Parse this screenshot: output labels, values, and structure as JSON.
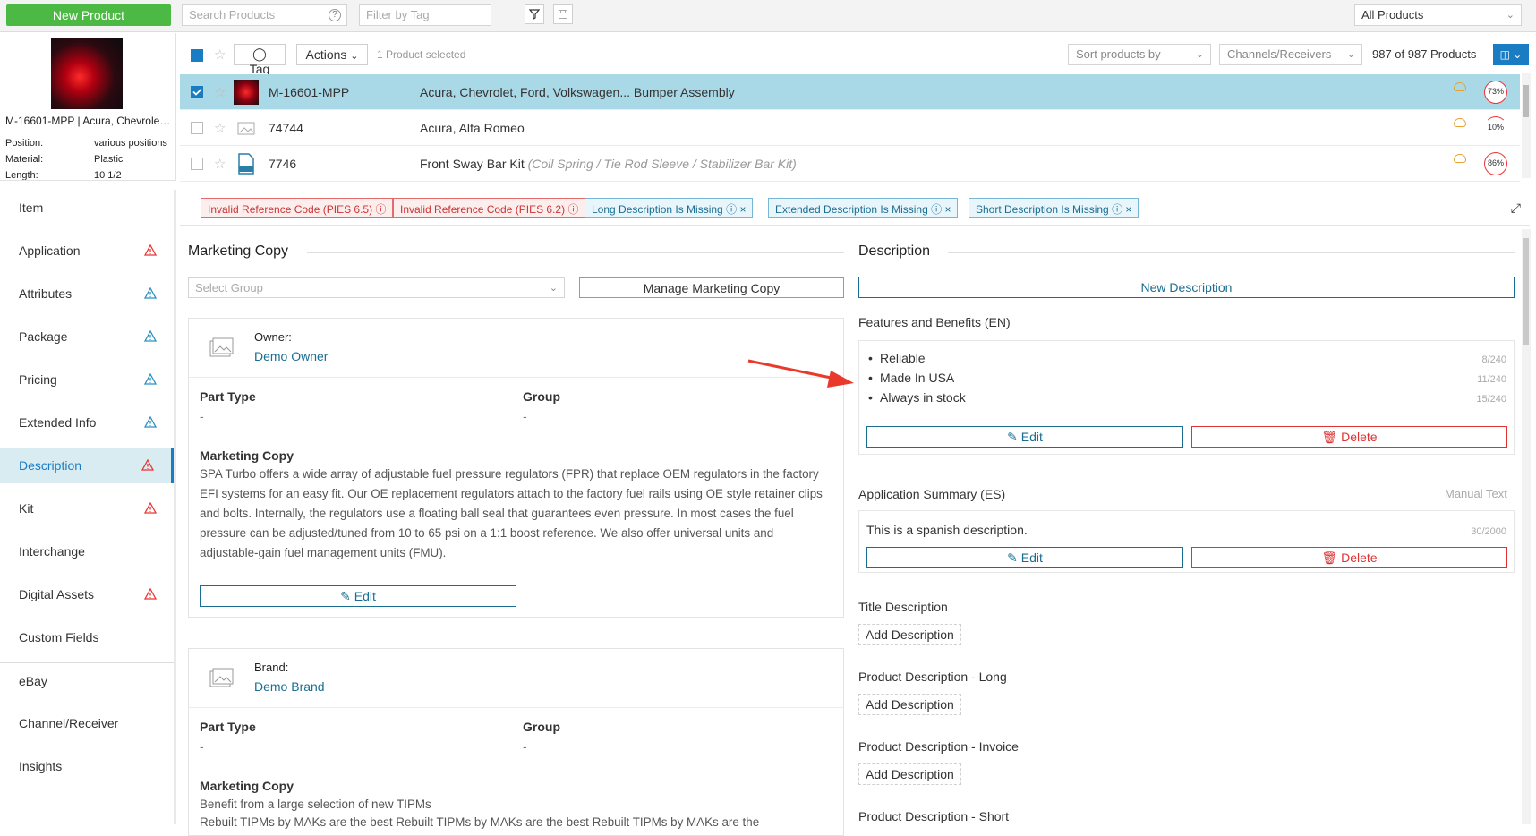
{
  "toolbar": {
    "new_product_label": "New Product",
    "search_placeholder": "Search Products",
    "tag_filter_placeholder": "Filter by Tag",
    "all_products": "All Products"
  },
  "preview": {
    "title": "M-16601-MPP | Acura, Chevrolet, Ford, Volkswagen...",
    "attributes": [
      {
        "label": "Position:",
        "value": "various positions"
      },
      {
        "label": "Material:",
        "value": "Plastic"
      },
      {
        "label": "Length:",
        "value": "10 1/2"
      }
    ]
  },
  "list": {
    "tag_label": "Tag",
    "actions_label": "Actions",
    "selected_text": "1 Product selected",
    "sort_placeholder": "Sort products by",
    "channels_placeholder": "Channels/Receivers",
    "count_text": "987 of 987 Products",
    "rows": [
      {
        "part": "M-16601-MPP",
        "desc": "Acura, Chevrolet, Ford, Volkswagen... Bumper Assembly",
        "extra": "",
        "pct": "73%",
        "selected": true
      },
      {
        "part": "74744",
        "desc": "Acura, Alfa Romeo",
        "extra": "",
        "pct": "10%",
        "selected": false
      },
      {
        "part": "7746",
        "desc": "Front Sway Bar Kit",
        "extra": "(Coil Spring / Tie Rod Sleeve / Stabilizer Bar Kit)",
        "pct": "86%",
        "selected": false
      }
    ]
  },
  "nav": [
    {
      "label": "Item",
      "warn": "none"
    },
    {
      "label": "Application",
      "warn": "red"
    },
    {
      "label": "Attributes",
      "warn": "blue"
    },
    {
      "label": "Package",
      "warn": "blue"
    },
    {
      "label": "Pricing",
      "warn": "blue"
    },
    {
      "label": "Extended Info",
      "warn": "blue"
    },
    {
      "label": "Description",
      "warn": "red",
      "active": true
    },
    {
      "label": "Kit",
      "warn": "red"
    },
    {
      "label": "Interchange",
      "warn": "none"
    },
    {
      "label": "Digital Assets",
      "warn": "red"
    },
    {
      "label": "Custom Fields",
      "warn": "none"
    },
    {
      "label": "eBay",
      "warn": "none"
    },
    {
      "label": "Channel/Receiver",
      "warn": "none"
    },
    {
      "label": "Insights",
      "warn": "none"
    }
  ],
  "issues": [
    {
      "label": "Invalid Reference Code (PIES 6.5)",
      "type": "error"
    },
    {
      "label": "Invalid Reference Code (PIES 6.2)",
      "type": "error"
    },
    {
      "label": "Long Description Is Missing",
      "type": "info"
    },
    {
      "label": "Extended Description Is Missing",
      "type": "info"
    },
    {
      "label": "Short Description Is Missing",
      "type": "info"
    }
  ],
  "marketing": {
    "title": "Marketing Copy",
    "select_group_placeholder": "Select Group",
    "manage_label": "Manage Marketing Copy",
    "cards": [
      {
        "owner_label": "Owner:",
        "owner_value": "Demo Owner",
        "part_type_label": "Part Type",
        "part_type_value": "-",
        "group_label": "Group",
        "group_value": "-",
        "copy_label": "Marketing Copy",
        "copy_text": "SPA Turbo offers a wide array of adjustable fuel pressure regulators (FPR) that replace OEM regulators in the factory EFI systems for an easy fit. Our OE replacement regulators attach to the factory fuel rails using OE style retainer clips and bolts. Internally, the regulators use a floating ball seal that guarantees even pressure. In most cases the fuel pressure can be adjusted/tuned from 10 to 65 psi on a 1:1 boost reference. We also offer universal units and adjustable-gain fuel management units (FMU).",
        "edit_label": "Edit"
      },
      {
        "owner_label": "Brand:",
        "owner_value": "Demo Brand",
        "part_type_label": "Part Type",
        "part_type_value": "-",
        "group_label": "Group",
        "group_value": "-",
        "copy_label": "Marketing Copy",
        "copy_text": "Benefit from a large selection of new TIPMs",
        "copy_text_2": "Rebuilt TIPMs by MAKs are the best Rebuilt TIPMs by MAKs are the best Rebuilt TIPMs by MAKs are the"
      }
    ]
  },
  "description": {
    "title": "Description",
    "new_label": "New Description",
    "features_title": "Features and Benefits (EN)",
    "features": [
      {
        "text": "Reliable",
        "count": "8/240"
      },
      {
        "text": "Made In USA",
        "count": "11/240"
      },
      {
        "text": "Always in stock",
        "count": "15/240"
      }
    ],
    "edit_label": "Edit",
    "delete_label": "Delete",
    "app_summary_title": "Application Summary (ES)",
    "manual_text": "Manual Text",
    "app_summary_text": "This is a spanish description.",
    "app_summary_count": "30/2000",
    "empty_sections": [
      {
        "title": "Title Description",
        "button": "Add Description"
      },
      {
        "title": "Product Description - Long",
        "button": "Add Description"
      },
      {
        "title": "Product Description - Invoice",
        "button": "Add Description"
      },
      {
        "title": "Product Description - Short",
        "button": ""
      }
    ]
  },
  "colors": {
    "accent": "#1a7dc4",
    "primary_green": "#4cb944",
    "error_red": "#dd3333",
    "info_blue": "#1a6e92",
    "selected_row": "#a9d8e6",
    "arrow": "#e8392b"
  }
}
